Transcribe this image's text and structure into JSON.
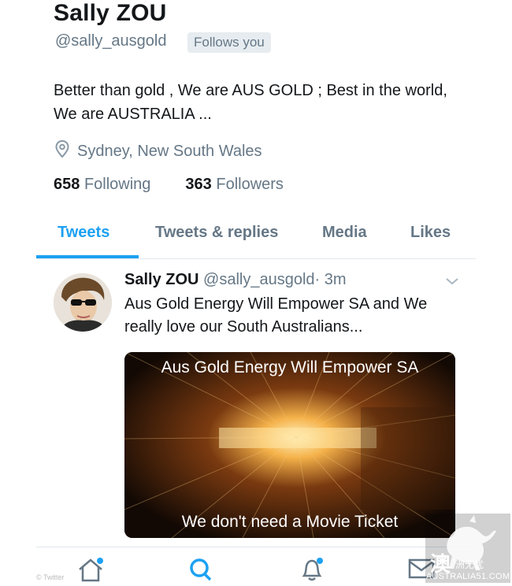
{
  "profile": {
    "name": "Sally ZOU",
    "handle": "@sally_ausgold",
    "follows_you": "Follows you",
    "bio": "Better than gold , We are AUS GOLD ; Best in the world, We are AUSTRALIA ...",
    "location": "Sydney, New South Wales",
    "following_count": "658",
    "following_label": "Following",
    "followers_count": "363",
    "followers_label": "Followers"
  },
  "tabs": [
    {
      "label": "Tweets",
      "active": true
    },
    {
      "label": "Tweets & replies",
      "active": false
    },
    {
      "label": "Media",
      "active": false
    },
    {
      "label": "Likes",
      "active": false
    }
  ],
  "tweet": {
    "name": "Sally ZOU",
    "handle": "@sally_ausgold",
    "time": "· 3m",
    "text": "Aus Gold Energy Will Empower SA and We really love our South Australians...",
    "media_caption_top": "Aus Gold Energy Will Empower SA",
    "media_caption_bottom": "We don't need a Movie Ticket"
  },
  "nav": {
    "items": [
      "home-icon",
      "search-icon",
      "notifications-icon",
      "messages-icon"
    ]
  },
  "credit": "© Twitter",
  "watermark": {
    "glyph": "澳",
    "small": "洲无忧",
    "text": "AUSTRALIA51.COM"
  },
  "colors": {
    "accent": "#1da1f2",
    "secondary_text": "#657786",
    "primary_text": "#14171a",
    "divider": "#e1e8ed"
  }
}
